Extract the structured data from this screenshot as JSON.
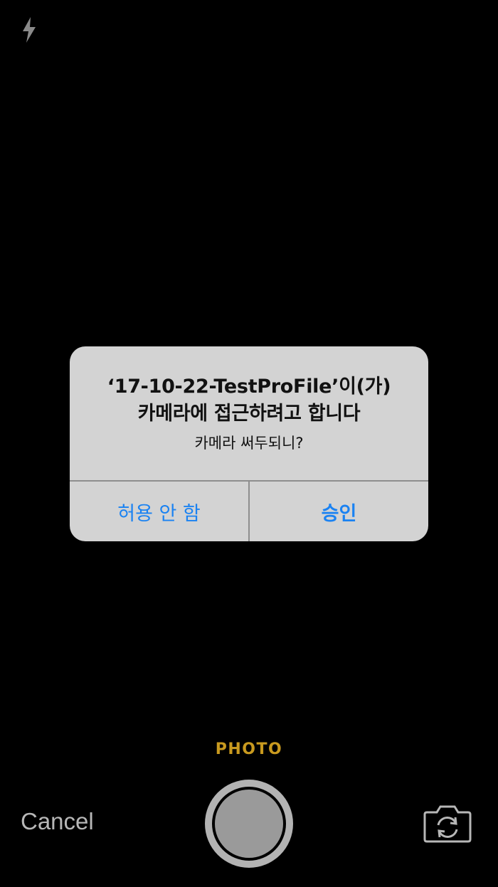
{
  "camera": {
    "flash_icon": "flash-icon",
    "mode_label": "PHOTO",
    "mode_color": "#c99a1f",
    "cancel_label": "Cancel",
    "shutter_icon": "shutter-button",
    "switch_camera_icon": "camera-flip-icon"
  },
  "alert": {
    "title_line1": "‘17-10-22-TestProFile’이(가)",
    "title_line2": "카메라에 접근하려고 합니다",
    "message": "카메라 써두되니?",
    "deny_label": "허용 안 함",
    "allow_label": "승인",
    "button_color": "#1a82f2"
  }
}
